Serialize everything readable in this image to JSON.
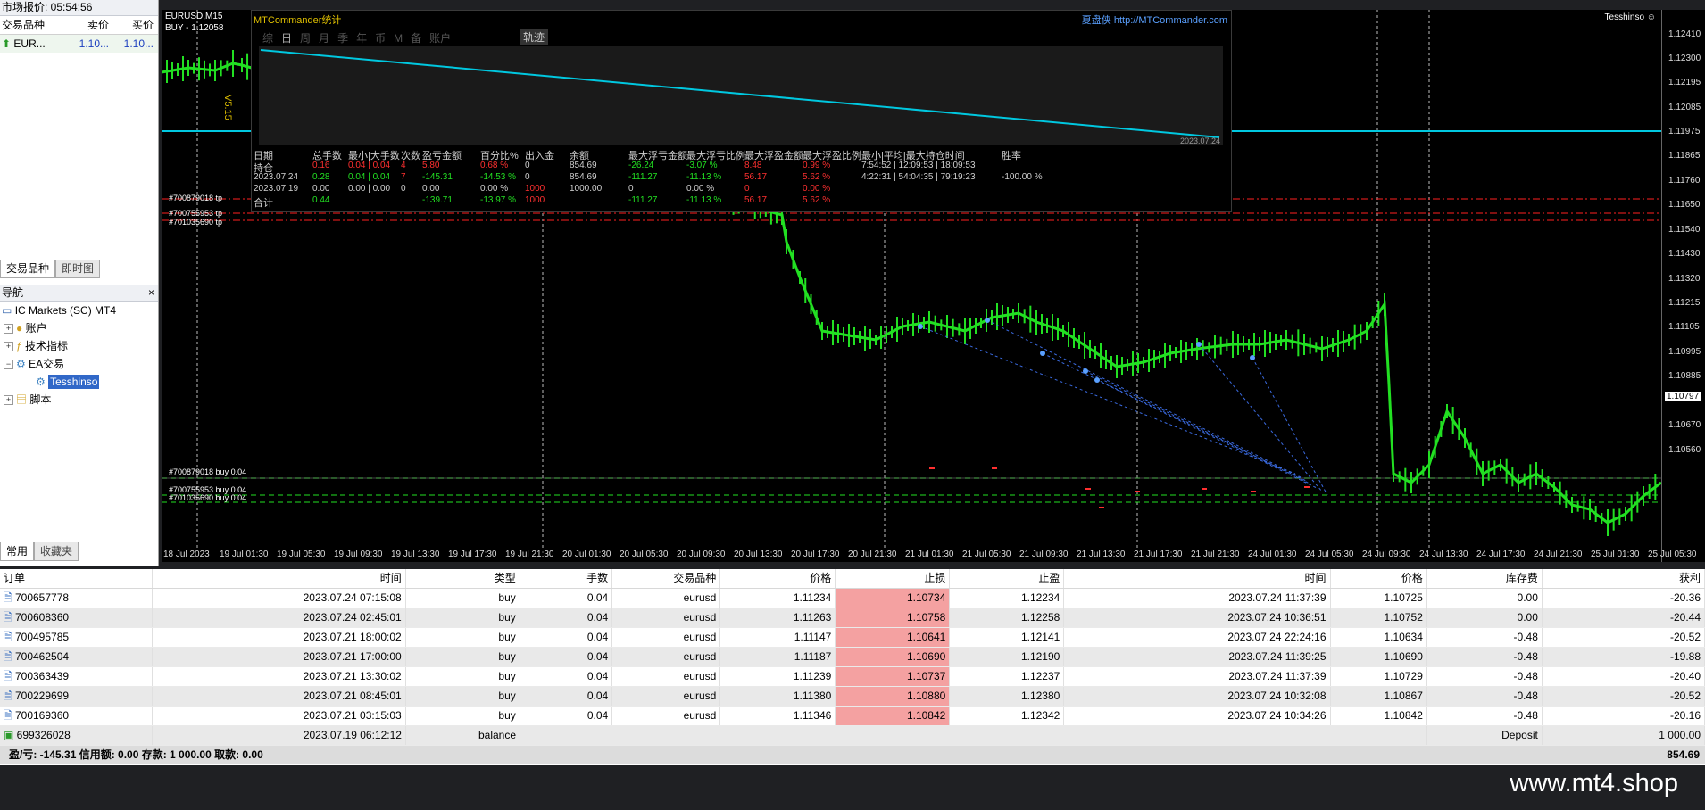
{
  "market_watch": {
    "title": "市场报价: 05:54:56",
    "col_symbol": "交易品种",
    "col_bid": "卖价",
    "col_ask": "买价",
    "row_symbol": "EUR...",
    "row_bid": "1.10...",
    "row_ask": "1.10...",
    "tab_symbols": "交易品种",
    "tab_tick": "即时图"
  },
  "navigator": {
    "title": "导航",
    "root": "IC Markets (SC) MT4",
    "accounts": "账户",
    "indicators": "技术指标",
    "ea": "EA交易",
    "ea_selected": "Tesshinso",
    "scripts": "脚本",
    "tab_common": "常用",
    "tab_favorites": "收藏夹"
  },
  "chart": {
    "symbol": "EURUSD,M15",
    "buy_line": "BUY - 1.12058",
    "version": "V5.15",
    "ea_name": "Tesshinso ☺",
    "price_ticks": [
      "1.12410",
      "1.12300",
      "1.12195",
      "1.12085",
      "1.11975",
      "1.11865",
      "1.11760",
      "1.11650",
      "1.11540",
      "1.11430",
      "1.11320",
      "1.11215",
      "1.11105",
      "1.10995",
      "1.10885",
      "1.10797",
      "1.10670",
      "1.10560"
    ],
    "current_price": "1.10797",
    "time_ticks": [
      "18 Jul 2023",
      "19 Jul 01:30",
      "19 Jul 05:30",
      "19 Jul 09:30",
      "19 Jul 13:30",
      "19 Jul 17:30",
      "19 Jul 21:30",
      "20 Jul 01:30",
      "20 Jul 05:30",
      "20 Jul 09:30",
      "20 Jul 13:30",
      "20 Jul 17:30",
      "20 Jul 21:30",
      "21 Jul 01:30",
      "21 Jul 05:30",
      "21 Jul 09:30",
      "21 Jul 13:30",
      "21 Jul 17:30",
      "21 Jul 21:30",
      "24 Jul 01:30",
      "24 Jul 05:30",
      "24 Jul 09:30",
      "24 Jul 13:30",
      "24 Jul 17:30",
      "24 Jul 21:30",
      "25 Jul 01:30",
      "25 Jul 05:30"
    ],
    "tp_labels": [
      "#700879018 tp",
      "#700755953 tp",
      "#701035690 tp"
    ],
    "buy_labels": [
      "#700879018 buy 0.04",
      "#700755953 buy 0.04",
      "#701035690 buy 0.04"
    ]
  },
  "stats_panel": {
    "title": "MTCommander统计",
    "brand": "夏盘侠",
    "url": "http://MTCommander.com",
    "tabs": [
      "综",
      "日",
      "周",
      "月",
      "季",
      "年",
      "币",
      "M",
      "备",
      "账户"
    ],
    "track_button": "轨迹",
    "graph_date": "2023.07.24",
    "headers": [
      "日期",
      "总手数",
      "最小|大手数",
      "次数",
      "盈亏金额",
      "百分比%",
      "出入金",
      "余额",
      "最大浮亏金额",
      "最大浮亏比例",
      "最大浮盈金额",
      "最大浮盈比例",
      "最小|平均|最大持仓时间",
      "胜率"
    ],
    "rows": [
      [
        "持仓",
        "0.16",
        "0.04 | 0.04",
        "4",
        "5.80",
        "0.68 %",
        "0",
        "854.69",
        "-26.24",
        "-3.07 %",
        "8.48",
        "0.99 %",
        "7:54:52 | 12:09:53 | 18:09:53",
        ""
      ],
      [
        "2023.07.24",
        "0.28",
        "0.04 | 0.04",
        "7",
        "-145.31",
        "-14.53 %",
        "0",
        "854.69",
        "-111.27",
        "-11.13 %",
        "56.17",
        "5.62 %",
        "4:22:31 | 54:04:35 | 79:19:23",
        "-100.00 %"
      ],
      [
        "2023.07.19",
        "0.00",
        "0.00 | 0.00",
        "0",
        "0.00",
        "0.00 %",
        "1000",
        "1000.00",
        "0",
        "0.00 %",
        "0",
        "0.00 %",
        "",
        ""
      ],
      [
        "合计",
        "0.44",
        "",
        "",
        "-139.71",
        "-13.97 %",
        "1000",
        "",
        "-111.27",
        "-11.13 %",
        "56.17",
        "5.62 %",
        "",
        ""
      ]
    ]
  },
  "terminal": {
    "headers": [
      "订单",
      "时间",
      "类型",
      "手数",
      "交易品种",
      "价格",
      "止损",
      "止盈",
      "时间",
      "价格",
      "库存费",
      "获利"
    ],
    "rows": [
      [
        "700657778",
        "2023.07.24 07:15:08",
        "buy",
        "0.04",
        "eurusd",
        "1.11234",
        "1.10734",
        "1.12234",
        "2023.07.24 11:37:39",
        "1.10725",
        "0.00",
        "-20.36"
      ],
      [
        "700608360",
        "2023.07.24 02:45:01",
        "buy",
        "0.04",
        "eurusd",
        "1.11263",
        "1.10758",
        "1.12258",
        "2023.07.24 10:36:51",
        "1.10752",
        "0.00",
        "-20.44"
      ],
      [
        "700495785",
        "2023.07.21 18:00:02",
        "buy",
        "0.04",
        "eurusd",
        "1.11147",
        "1.10641",
        "1.12141",
        "2023.07.24 22:24:16",
        "1.10634",
        "-0.48",
        "-20.52"
      ],
      [
        "700462504",
        "2023.07.21 17:00:00",
        "buy",
        "0.04",
        "eurusd",
        "1.11187",
        "1.10690",
        "1.12190",
        "2023.07.24 11:39:25",
        "1.10690",
        "-0.48",
        "-19.88"
      ],
      [
        "700363439",
        "2023.07.21 13:30:02",
        "buy",
        "0.04",
        "eurusd",
        "1.11239",
        "1.10737",
        "1.12237",
        "2023.07.24 11:37:39",
        "1.10729",
        "-0.48",
        "-20.40"
      ],
      [
        "700229699",
        "2023.07.21 08:45:01",
        "buy",
        "0.04",
        "eurusd",
        "1.11380",
        "1.10880",
        "1.12380",
        "2023.07.24 10:32:08",
        "1.10867",
        "-0.48",
        "-20.52"
      ],
      [
        "700169360",
        "2023.07.21 03:15:03",
        "buy",
        "0.04",
        "eurusd",
        "1.11346",
        "1.10842",
        "1.12342",
        "2023.07.24 10:34:26",
        "1.10842",
        "-0.48",
        "-20.16"
      ]
    ],
    "balance_row": {
      "order": "699326028",
      "time": "2023.07.19 06:12:12",
      "type": "balance",
      "comment": "Deposit",
      "amount": "1 000.00"
    },
    "footer_text": "盈/亏: -145.31  信用额: 0.00  存款: 1 000.00  取款: 0.00",
    "footer_total": "854.69"
  },
  "watermark": "www.mt4.shop",
  "colors": {
    "green": "#22e022",
    "cyan": "#00c8e0",
    "red": "#ff2020",
    "sl_bg": "#f4a1a1"
  }
}
